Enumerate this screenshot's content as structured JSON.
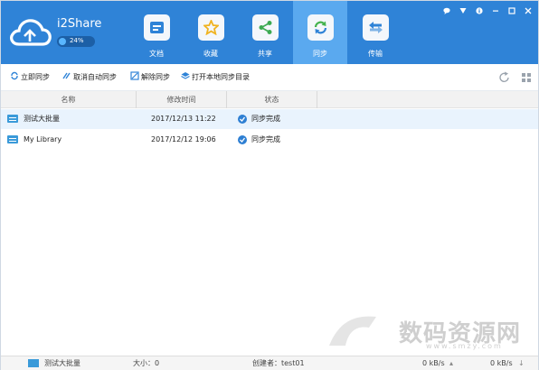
{
  "app": {
    "name": "i2Share",
    "usage_percent": "24%"
  },
  "nav": [
    {
      "label": "文档",
      "icon": "document-icon",
      "active": false
    },
    {
      "label": "收藏",
      "icon": "star-icon",
      "active": false
    },
    {
      "label": "共享",
      "icon": "share-icon",
      "active": false
    },
    {
      "label": "同步",
      "icon": "sync-icon",
      "active": true
    },
    {
      "label": "传输",
      "icon": "transfer-icon",
      "active": false
    }
  ],
  "window_controls": [
    "chat-icon",
    "wifi-icon",
    "info-icon",
    "minimize-icon",
    "maximize-icon",
    "close-icon"
  ],
  "toolbar": {
    "sync_now": "立即同步",
    "cancel_auto_sync": "取消自动同步",
    "unsync": "解除同步",
    "open_local_dir": "打开本地同步目录",
    "right_icons": [
      "refresh-icon",
      "grid-view-icon"
    ]
  },
  "table": {
    "headers": [
      "名称",
      "修改时间",
      "状态"
    ],
    "rows": [
      {
        "name": "测试大批量",
        "time": "2017/12/13 11:22",
        "status": "同步完成",
        "selected": true
      },
      {
        "name": "My Library",
        "time": "2017/12/12 19:06",
        "status": "同步完成",
        "selected": false
      }
    ]
  },
  "statusbar": {
    "selected_name": "测试大批量",
    "size": "大小：0",
    "creator": "创建者：test01",
    "upload": "0 kB/s",
    "download": "0 kB/s"
  },
  "watermark": {
    "text": "数码资源网",
    "url": "www.smzy.com"
  },
  "colors": {
    "header": "#2f83d7",
    "active_tab": "#5aa9ef",
    "selected_row": "#e9f3fd"
  }
}
